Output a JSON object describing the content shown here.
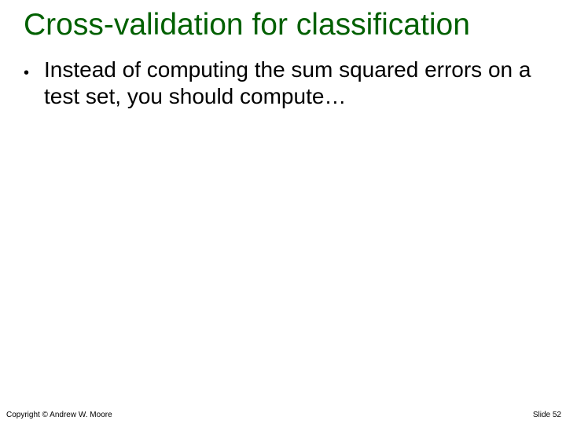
{
  "title": "Cross-validation for classification",
  "bullets": [
    "Instead of computing the sum squared errors on a test set, you should compute…"
  ],
  "footer": {
    "copyright": "Copyright © Andrew W. Moore",
    "slide": "Slide 52"
  }
}
